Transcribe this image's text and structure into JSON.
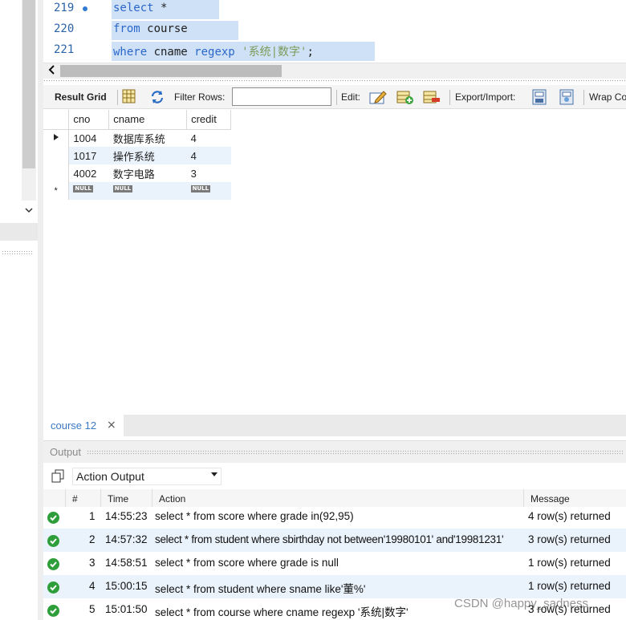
{
  "editor": {
    "lines": [
      {
        "number": "219",
        "tokens": [
          {
            "t": "select ",
            "c": "kw"
          },
          {
            "t": "*",
            "c": "plain"
          }
        ]
      },
      {
        "number": "220",
        "tokens": [
          {
            "t": "from ",
            "c": "kw"
          },
          {
            "t": "course",
            "c": "plain"
          }
        ]
      },
      {
        "number": "221",
        "tokens": [
          {
            "t": "where ",
            "c": "kw"
          },
          {
            "t": "cname ",
            "c": "plain"
          },
          {
            "t": "regexp ",
            "c": "kw"
          },
          {
            "t": "'系统|数字'",
            "c": "str"
          },
          {
            "t": ";",
            "c": "plain"
          }
        ]
      }
    ]
  },
  "toolbar": {
    "result_grid": "Result Grid",
    "filter_rows": "Filter Rows:",
    "filter_value": "",
    "edit": "Edit:",
    "export_import": "Export/Import:",
    "wrap": "Wrap Co"
  },
  "grid": {
    "columns": [
      "cno",
      "cname",
      "credit"
    ],
    "rows": [
      [
        "1004",
        "数据库系统",
        "4"
      ],
      [
        "1017",
        "操作系统",
        "4"
      ],
      [
        "4002",
        "数字电路",
        "3"
      ]
    ],
    "null_label": "NULL"
  },
  "tabs": {
    "course": "course 12",
    "close": "×"
  },
  "output": {
    "title": "Output",
    "selector": "Action Output",
    "headers": [
      "#",
      "Time",
      "Action",
      "Message"
    ],
    "rows": [
      {
        "n": "1",
        "time": "14:55:23",
        "action": "select * from score where grade in(92,95)",
        "message": "4 row(s) returned"
      },
      {
        "n": "2",
        "time": "14:57:32",
        "action": "select * from student where sbirthday not between'19980101' and'19981231'",
        "message": "3 row(s) returned"
      },
      {
        "n": "3",
        "time": "14:58:51",
        "action": "select * from score where grade is null",
        "message": "1 row(s) returned"
      },
      {
        "n": "4",
        "time": "15:00:15",
        "action": "select * from student where sname like'董%'",
        "message": "1 row(s) returned"
      },
      {
        "n": "5",
        "time": "15:01:50",
        "action": "select * from course where cname regexp '系统|数字'",
        "message": "3 row(s) returned"
      }
    ]
  },
  "watermark": "CSDN @happy_sadness",
  "colors": {
    "keyword": "#2b67c9",
    "string": "#7a9b58",
    "selection": "#cfe1f7",
    "ok": "#2e9e3a"
  }
}
